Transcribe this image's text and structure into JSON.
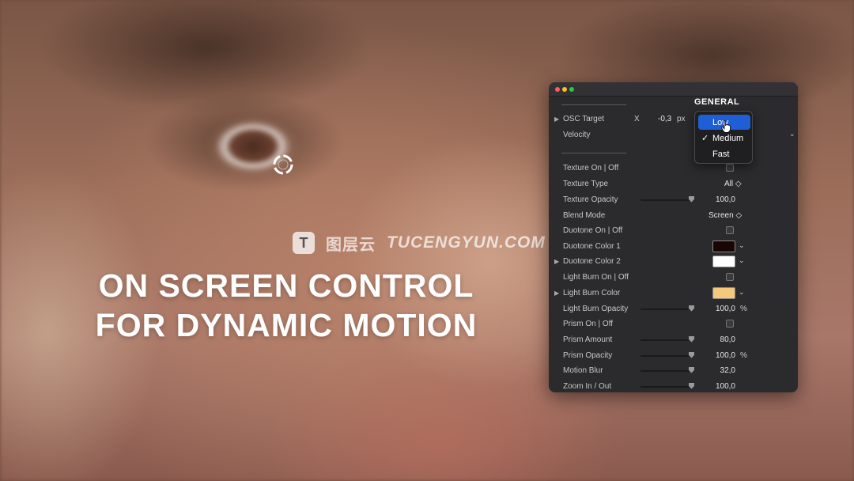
{
  "watermark": {
    "logo": "T",
    "cn": "图层云",
    "en": "TUCENGYUN.COM"
  },
  "headline": {
    "line1": "ON SCREEN CONTROL",
    "line2": "FOR DYNAMIC MOTION"
  },
  "panel": {
    "section_title": "GENERAL",
    "osc": {
      "label": "OSC Target",
      "axis": "X",
      "value": "-0,3",
      "unit": "px"
    },
    "velocity": {
      "label": "Velocity"
    },
    "velocity_menu": {
      "options": [
        "Low",
        "Medium",
        "Fast"
      ],
      "highlighted": "Low",
      "checked": "Medium",
      "check_mark": "✓"
    },
    "rows": {
      "texture_on": {
        "label": "Texture On | Off"
      },
      "texture_type": {
        "label": "Texture Type",
        "value": "All ◇"
      },
      "texture_opacity": {
        "label": "Texture Opacity",
        "value": "100,0"
      },
      "blend_mode": {
        "label": "Blend Mode",
        "value": "Screen ◇"
      },
      "duotone_on": {
        "label": "Duotone On | Off"
      },
      "duotone_color1": {
        "label": "Duotone Color 1",
        "color": "#1a0505"
      },
      "duotone_color2": {
        "label": "Duotone Color 2",
        "color": "#ffffff"
      },
      "light_burn_on": {
        "label": "Light Burn On | Off"
      },
      "light_burn_color": {
        "label": "Light Burn Color",
        "color": "#f5c97a"
      },
      "light_burn_opacity": {
        "label": "Light Burn Opacity",
        "value": "100,0",
        "unit": "%"
      },
      "prism_on": {
        "label": "Prism On | Off"
      },
      "prism_amount": {
        "label": "Prism Amount",
        "value": "80,0"
      },
      "prism_opacity": {
        "label": "Prism Opacity",
        "value": "100,0",
        "unit": "%"
      },
      "motion_blur": {
        "label": "Motion Blur",
        "value": "32,0"
      },
      "zoom": {
        "label": "Zoom In / Out",
        "value": "100,0"
      }
    }
  },
  "colors": {
    "accent": "#1f5fd6",
    "panel_bg": "#2b2b2d"
  },
  "icons": {
    "reticle": "target-reticle-icon",
    "cursor": "pointer-hand-icon",
    "disclosure": "disclosure-triangle-icon"
  }
}
